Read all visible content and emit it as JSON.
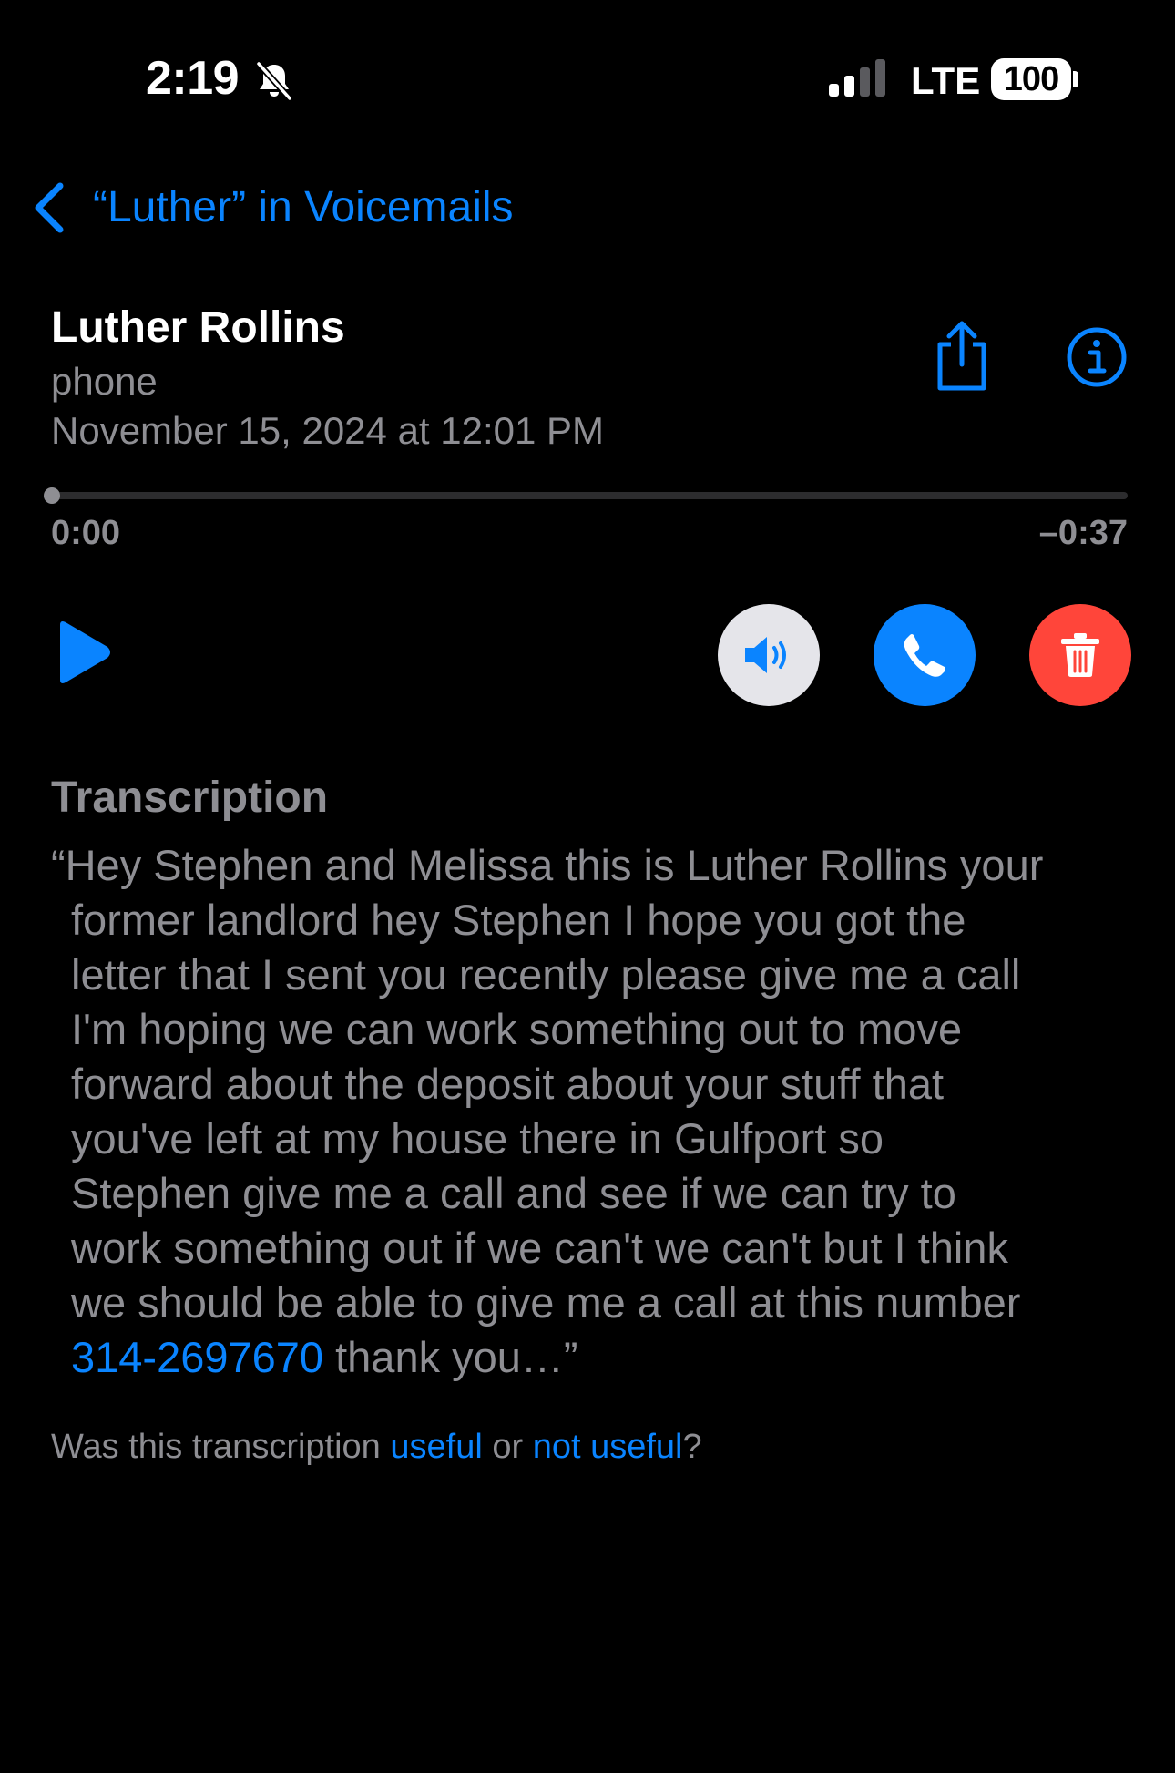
{
  "status_bar": {
    "time": "2:19",
    "network": "LTE",
    "battery": "100"
  },
  "nav": {
    "back_label": "“Luther” in Voicemails"
  },
  "voicemail": {
    "name": "Luther Rollins",
    "label": "phone",
    "date": "November 15, 2024 at 12:01 PM",
    "elapsed": "0:00",
    "remaining": "–0:37",
    "progress_fraction": 0
  },
  "transcription": {
    "heading": "Transcription",
    "lines": [
      "“Hey Stephen and Melissa this is Luther Rollins your",
      "former landlord hey Stephen I hope you got the",
      "letter that I sent you recently please give me a call",
      "I'm hoping we can work something out to move",
      "forward about the deposit about your stuff that",
      "you've left at my house there in Gulfport so",
      "Stephen give me a call and see if we can try to",
      "work something out if we can't we can't but I think",
      "we should be able to give me a call at this number"
    ],
    "phone_number": "314-2697670",
    "ending": " thank you…”"
  },
  "feedback": {
    "prefix": "Was this transcription ",
    "useful": "useful",
    "middle": " or ",
    "not_useful": "not useful",
    "suffix": "?"
  },
  "colors": {
    "accent": "#0a84ff",
    "delete": "#ff453a",
    "secondary_text": "#8e8e93",
    "speaker_bg": "#e5e5ea"
  }
}
